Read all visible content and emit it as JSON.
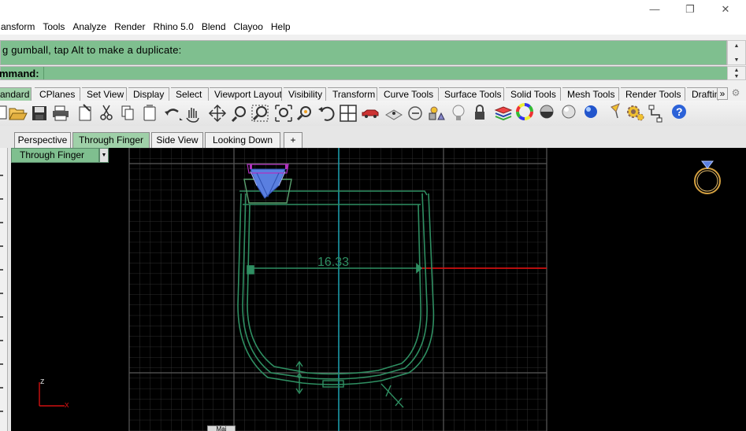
{
  "window": {
    "minimize_glyph": "—",
    "restore_glyph": "❐",
    "close_glyph": "✕"
  },
  "menu": [
    "ansform",
    "Tools",
    "Analyze",
    "Render",
    "Rhino 5.0",
    "Blend",
    "Clayoo",
    "Help"
  ],
  "command_history": {
    "text": "g gumball, tap Alt to make a duplicate:"
  },
  "command_line": {
    "prompt": "mmand:",
    "value": ""
  },
  "toolbar_tabs": [
    {
      "label": "andard",
      "active": true
    },
    {
      "label": "CPlanes"
    },
    {
      "label": "Set View"
    },
    {
      "label": "Display"
    },
    {
      "label": "Select"
    },
    {
      "label": "Viewport Layout"
    },
    {
      "label": "Visibility"
    },
    {
      "label": "Transform"
    },
    {
      "label": "Curve Tools"
    },
    {
      "label": "Surface Tools"
    },
    {
      "label": "Solid Tools"
    },
    {
      "label": "Mesh Tools"
    },
    {
      "label": "Render Tools"
    },
    {
      "label": "Draftin"
    }
  ],
  "toolbar_overflow": "»",
  "toolbar_icons": [
    "new-file-icon",
    "open-folder-icon",
    "save-icon",
    "print-icon",
    "import-icon",
    "cut-icon",
    "copy-icon",
    "paste-icon",
    "undo-icon",
    "pan-icon",
    "rotate-view-icon",
    "zoom-icon",
    "zoom-window-icon",
    "zoom-extents-icon",
    "zoom-selected-icon",
    "rotate-icon",
    "four-views-icon",
    "car-icon",
    "construction-plane-icon",
    "circle-tool-icon",
    "shapes-icon",
    "lock-icon",
    "bulb-icon",
    "layers-icon",
    "color-wheel-icon",
    "sphere-gray-icon",
    "sphere-shaded-icon",
    "sphere-blue-icon",
    "lamp-icon",
    "settings-icon",
    "connect-icon",
    "help-icon"
  ],
  "viewport_tabs": [
    "Perspective",
    "Through Finger",
    "Side View",
    "Looking Down"
  ],
  "viewport_tab_add": "+",
  "viewport": {
    "name": "Through Finger",
    "dimension_label": "16.33",
    "axis_z": "z",
    "axis_x": "x"
  },
  "mini_tab_label": "Mai",
  "colors": {
    "accent_green": "#7fbf8f",
    "curve_green": "#2f8f62",
    "axis_red": "#d01010",
    "axis_cyan": "#1b9aa8",
    "stone_blue": "#5a7fe0",
    "ring_gold": "#d4a040"
  }
}
